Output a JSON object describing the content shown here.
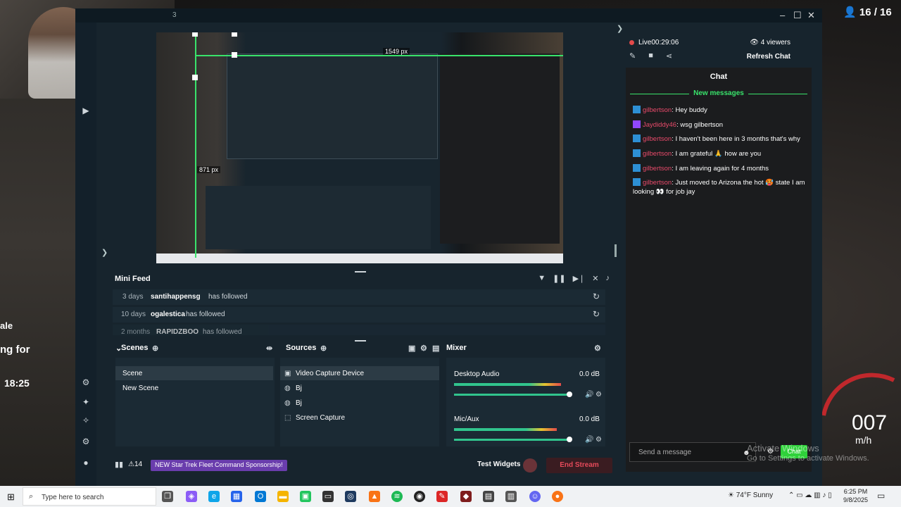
{
  "overlay": {
    "viewer_counter": "16 / 16",
    "left_frag_1": "ale",
    "left_frag_2": "ng for",
    "left_frag_3": "18:25",
    "gauge_speed": "007",
    "gauge_unit": "m/h",
    "watermark_line1": "Activate Windows",
    "watermark_line2": "Go to Settings to activate Windows."
  },
  "app": {
    "title_number": "3",
    "preview": {
      "dimension_w": "1549 px",
      "dimension_h": "871 px"
    },
    "mini_feed": {
      "title": "Mini Feed",
      "rows": [
        {
          "age": "3 days",
          "user": "santihappensg",
          "action": "has followed"
        },
        {
          "age": "10 days",
          "user": "ogalestica",
          "action": "has followed"
        },
        {
          "age": "2 months",
          "user": "RAPIDZBOO",
          "action": "has followed"
        }
      ]
    },
    "scenes": {
      "title": "Scenes",
      "items": [
        "Scene",
        "New Scene"
      ]
    },
    "sources": {
      "title": "Sources",
      "items": [
        {
          "label": "Video Capture Device",
          "icon": "camera-icon"
        },
        {
          "label": "Bj",
          "icon": "globe-icon"
        },
        {
          "label": "Bj",
          "icon": "globe-icon"
        },
        {
          "label": "Screen Capture",
          "icon": "screen-capture-icon"
        }
      ]
    },
    "mixer": {
      "title": "Mixer",
      "channels": [
        {
          "name": "Desktop Audio",
          "db": "0.0 dB",
          "level": 0.85,
          "volume": 1.0
        },
        {
          "name": "Mic/Aux",
          "db": "0.0 dB",
          "level": 0.82,
          "volume": 1.0
        }
      ]
    },
    "footer": {
      "count": "14",
      "promo": "NEW Star Trek Fleet Command Sponsorship!",
      "test_widgets": "Test Widgets",
      "end_stream": "End Stream"
    },
    "chat": {
      "live_label": "Live",
      "live_time": "00:29:06",
      "viewers": "4 viewers",
      "refresh": "Refresh Chat",
      "title": "Chat",
      "new_messages": "New messages",
      "messages": [
        {
          "name": "gilbertson",
          "text": ": Hey buddy",
          "badge": "blue"
        },
        {
          "name": "Jaydiddy46",
          "text": ": wsg gilbertson",
          "badge": "purple"
        },
        {
          "name": "gilbertson",
          "text": ": I haven't been here in 3 months that's why",
          "badge": "blue"
        },
        {
          "name": "gilbertson",
          "text": ": I am grateful 🙏 how are you",
          "badge": "blue"
        },
        {
          "name": "gilbertson",
          "text": ": I am leaving again for 4 months",
          "badge": "blue"
        },
        {
          "name": "gilbertson",
          "text": ": Just moved to Arizona the hot 🥵 state I am looking 👀 for job jay",
          "badge": "blue"
        }
      ],
      "input_placeholder": "Send a message",
      "send_label": "Chat"
    }
  },
  "taskbar": {
    "search_placeholder": "Type here to search",
    "weather": "74°F  Sunny",
    "time": "6:25 PM",
    "date": "9/8/2025"
  }
}
